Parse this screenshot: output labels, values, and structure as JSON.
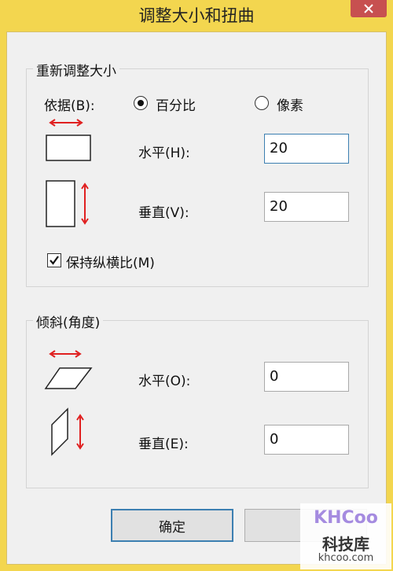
{
  "window": {
    "title": "调整大小和扭曲"
  },
  "resize": {
    "group_label": "重新调整大小",
    "by_label": "依据(B):",
    "options": [
      {
        "label": "百分比",
        "selected": true
      },
      {
        "label": "像素",
        "selected": false
      }
    ],
    "horizontal_label": "水平(H):",
    "horizontal_value": "20",
    "vertical_label": "垂直(V):",
    "vertical_value": "20",
    "keep_ratio_label": "保持纵横比(M)",
    "keep_ratio_checked": true
  },
  "skew": {
    "group_label": "倾斜(角度)",
    "horizontal_label": "水平(O):",
    "horizontal_value": "0",
    "vertical_label": "垂直(E):",
    "vertical_value": "0"
  },
  "buttons": {
    "ok_label": "确定",
    "cancel_label": ""
  },
  "watermark": {
    "brand": "KHCoo",
    "cn_name": "科技库",
    "site": "khcoo.com"
  },
  "colors": {
    "frame": "#f3d64f",
    "arrow": "#e02020",
    "close": "#c75050",
    "focus": "#3c7fb1"
  },
  "icons": [
    "close-icon",
    "resize-horizontal-icon",
    "resize-vertical-icon",
    "skew-horizontal-icon",
    "skew-vertical-icon",
    "check-icon"
  ]
}
